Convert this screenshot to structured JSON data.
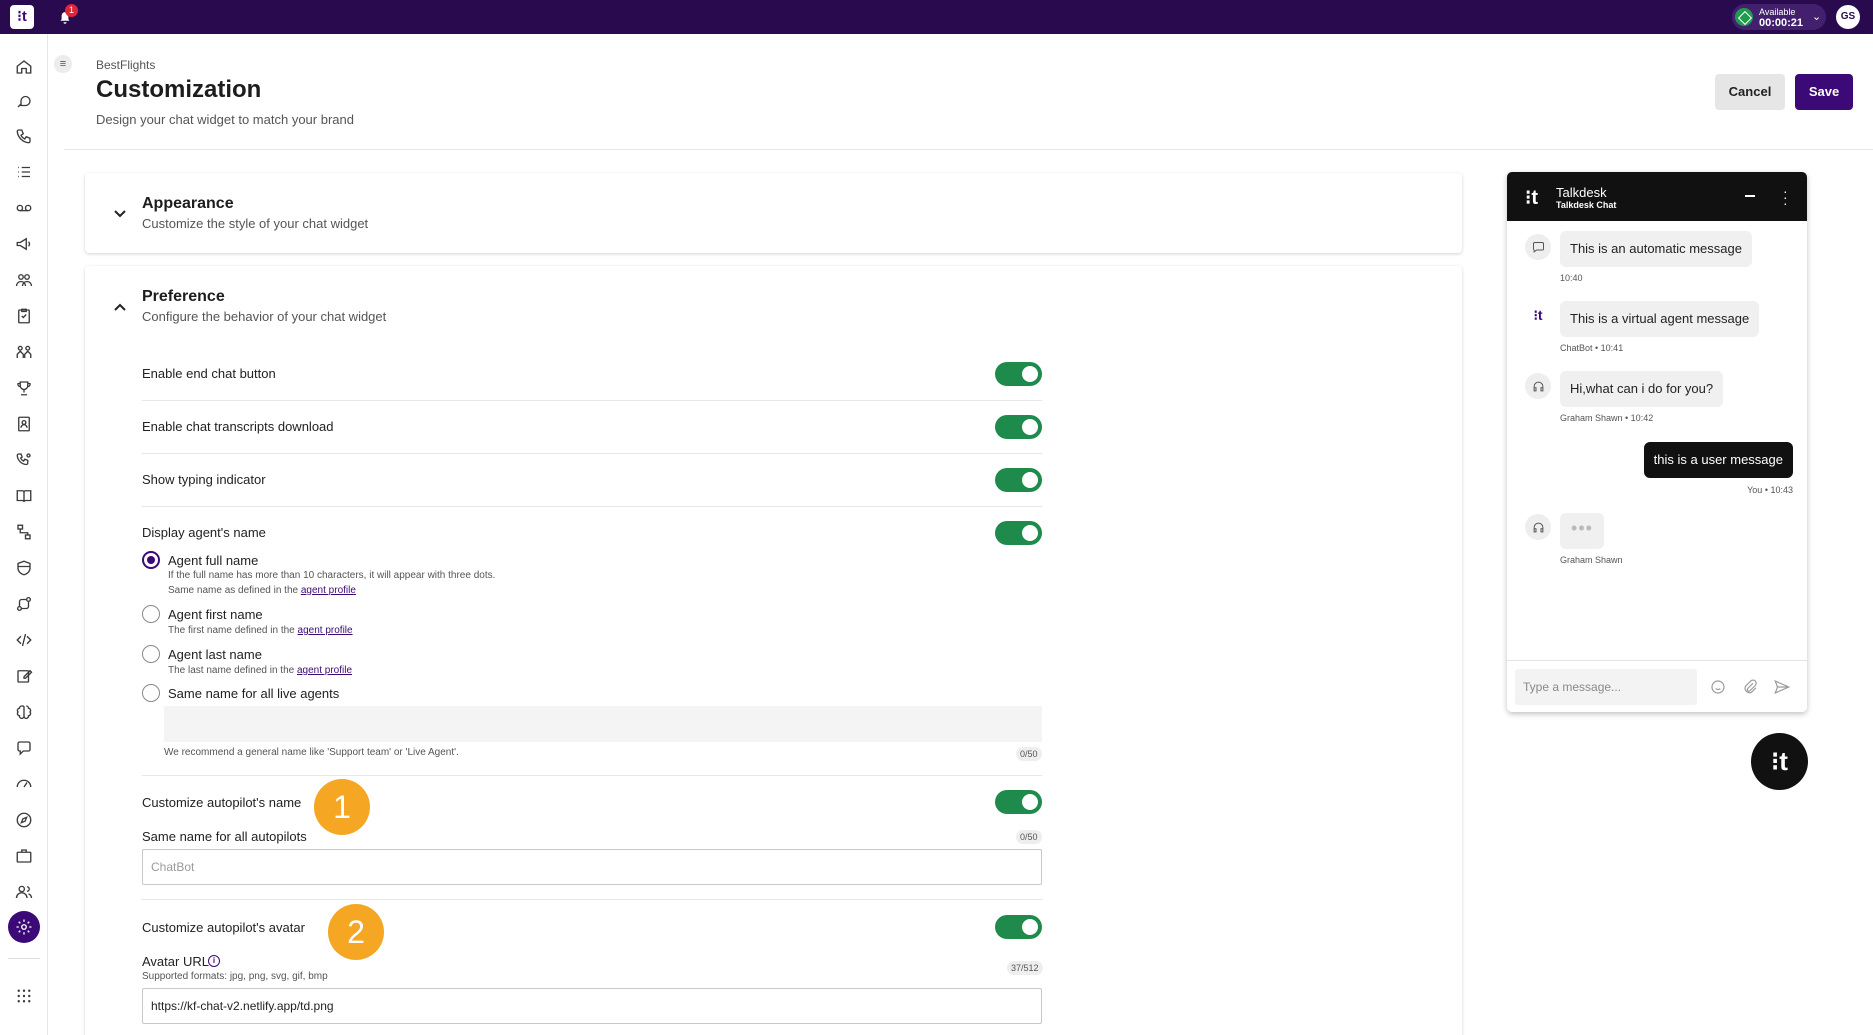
{
  "topbar": {
    "logo": "⁝t",
    "notification_count": "1",
    "status_label": "Available",
    "status_time": "00:00:21",
    "user_initials": "GS"
  },
  "sidebar": {
    "items": [
      {
        "name": "home-icon"
      },
      {
        "name": "conversations-icon"
      },
      {
        "name": "calls-icon"
      },
      {
        "name": "lists-icon"
      },
      {
        "name": "voicemail-icon"
      },
      {
        "name": "campaigns-icon"
      },
      {
        "name": "teams-icon"
      },
      {
        "name": "tasks-icon"
      },
      {
        "name": "people-icon"
      },
      {
        "name": "trophy-icon"
      },
      {
        "name": "contacts-icon"
      },
      {
        "name": "routing-icon"
      },
      {
        "name": "knowledge-icon"
      },
      {
        "name": "workflow-icon"
      },
      {
        "name": "shield-icon"
      },
      {
        "name": "integrations-icon"
      },
      {
        "name": "code-icon"
      },
      {
        "name": "edit-icon"
      },
      {
        "name": "ai-icon"
      },
      {
        "name": "chat-icon"
      },
      {
        "name": "speed-icon"
      },
      {
        "name": "explore-icon"
      },
      {
        "name": "briefcase-icon"
      },
      {
        "name": "users-icon"
      },
      {
        "name": "settings-icon",
        "active": true
      },
      {
        "name": "apps-icon"
      }
    ]
  },
  "header": {
    "breadcrumb": "BestFlights",
    "title": "Customization",
    "subtitle": "Design your chat widget to match your brand",
    "cancel_label": "Cancel",
    "save_label": "Save"
  },
  "appearance": {
    "title": "Appearance",
    "subtitle": "Customize the style of your chat widget"
  },
  "preference": {
    "title": "Preference",
    "subtitle": "Configure the behavior of your chat widget",
    "toggles": {
      "end_chat": {
        "label": "Enable end chat button",
        "on": true
      },
      "transcripts": {
        "label": "Enable chat transcripts download",
        "on": true
      },
      "typing": {
        "label": "Show typing indicator",
        "on": true
      },
      "agent_name": {
        "label": "Display agent's name",
        "on": true
      }
    },
    "radios": {
      "full": {
        "label": "Agent full name",
        "help1": "If the full name has more than 10 characters, it will appear with three dots.",
        "help2_prefix": "Same name as defined in the ",
        "link": "agent profile",
        "selected": true
      },
      "first": {
        "label": "Agent first name",
        "help_prefix": "The first name defined in the ",
        "link": "agent profile"
      },
      "last": {
        "label": "Agent last name",
        "help_prefix": "The last name defined in the ",
        "link": "agent profile"
      },
      "same": {
        "label": "Same name for all live agents"
      }
    },
    "live_agent_name": {
      "value": "",
      "hint": "We recommend a general name like 'Support team' or 'Live Agent'.",
      "counter": "0/50"
    },
    "autopilot_name": {
      "toggle_label": "Customize autopilot's name",
      "on": true,
      "field_label": "Same name for all autopilots",
      "placeholder": "ChatBot",
      "counter": "0/50"
    },
    "autopilot_avatar": {
      "toggle_label": "Customize autopilot's avatar",
      "on": true,
      "field_label": "Avatar URL",
      "help": "Supported formats: jpg, png, svg, gif, bmp",
      "counter": "37/512",
      "value": "https://kf-chat-v2.netlify.app/td.png"
    },
    "callouts": {
      "one": "1",
      "two": "2"
    }
  },
  "chat_preview": {
    "title": "Talkdesk",
    "subtitle": "Talkdesk Chat",
    "messages": [
      {
        "text": "This is an automatic message",
        "meta": "10:40",
        "avatar": "message-bubble-icon"
      },
      {
        "text": "This is a virtual agent message",
        "meta": "ChatBot • 10:41",
        "avatar": "bot-logo-icon"
      },
      {
        "text": "Hi,what can i do for you?",
        "meta": "Graham Shawn • 10:42",
        "avatar": "agent-headset-icon"
      },
      {
        "text": "this is a user message",
        "meta": "You • 10:43"
      },
      {
        "text": "•••",
        "meta": "Graham Shawn",
        "avatar": "agent-headset-icon"
      }
    ],
    "input_placeholder": "Type a message...",
    "launcher_logo": "⁝t"
  },
  "colors": {
    "brand": "#3b0a76",
    "topbar": "#2a0a4f",
    "toggle_on": "#1e8a4c",
    "callout": "#f5a623"
  }
}
